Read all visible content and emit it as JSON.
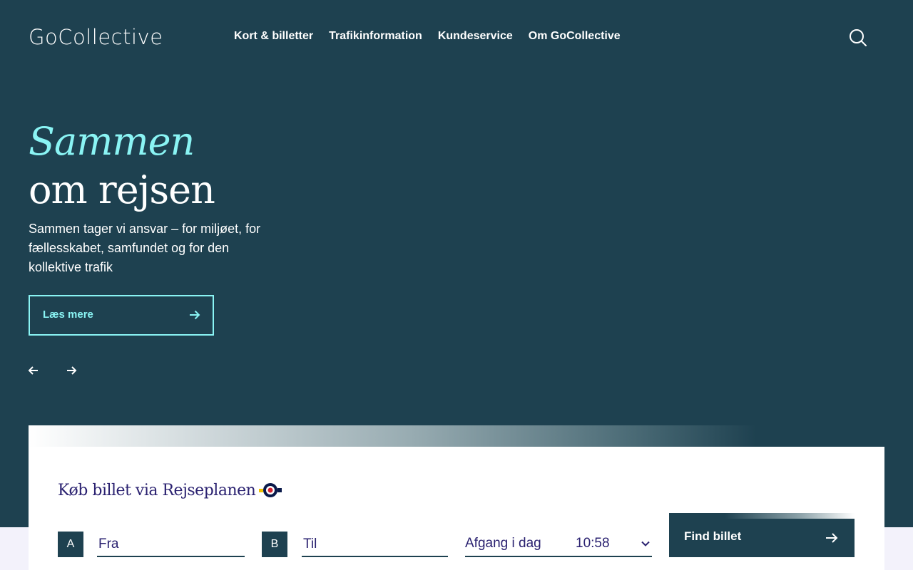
{
  "header": {
    "logo": "GoCollective",
    "nav": [
      "Kort & billetter",
      "Trafikinformation",
      "Kundeservice",
      "Om GoCollective"
    ],
    "search_icon": "search-icon"
  },
  "hero": {
    "headline_italic": "Sammen",
    "headline": "om rejsen",
    "description": "Sammen tager vi ansvar – for miljøet, for fællesskabet, samfundet og for den kollektive trafik",
    "cta_label": "Læs mere",
    "cta_icon": "arrow-right-icon",
    "prev_icon": "arrow-left-icon",
    "next_icon": "arrow-right-icon"
  },
  "booking": {
    "title": "Køb billet via Rejseplanen",
    "from_badge": "A",
    "from_placeholder": "Fra",
    "to_badge": "B",
    "to_placeholder": "Til",
    "departure_label": "Afgang i dag",
    "departure_time": "10:58",
    "submit_label": "Find billet"
  },
  "colors": {
    "hero_bg": "#1e4150",
    "accent": "#8af4f4",
    "title_text": "#2a2170",
    "page_bg": "#f3f2fb"
  }
}
